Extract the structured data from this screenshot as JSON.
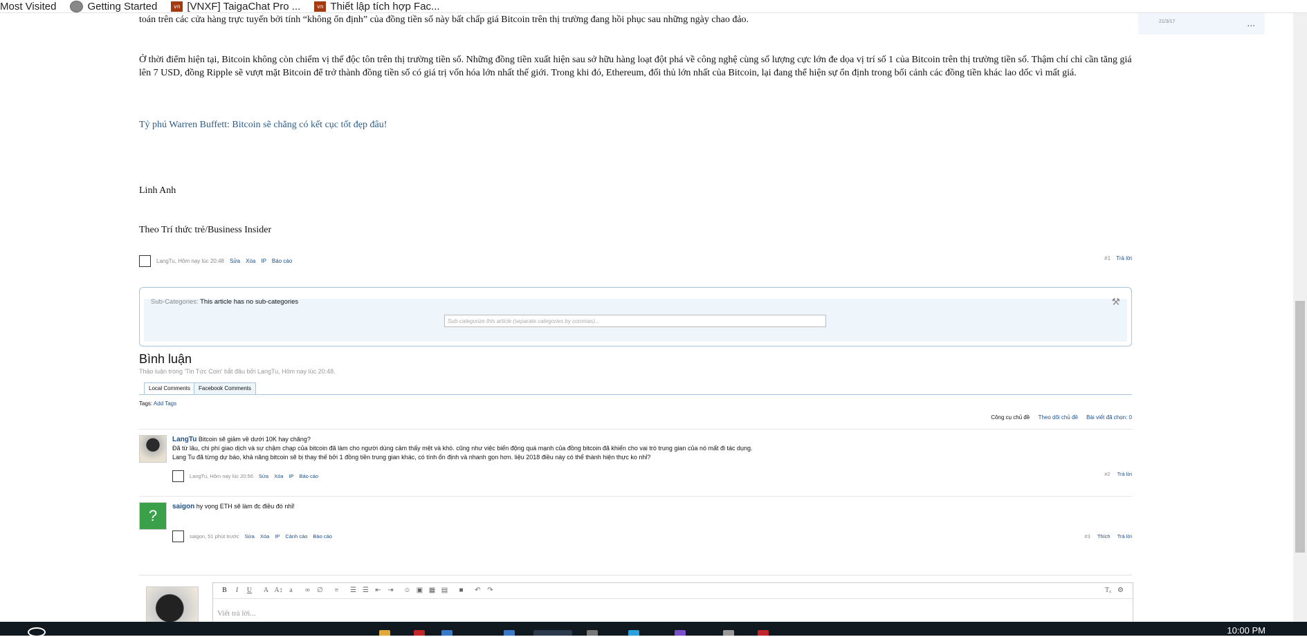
{
  "bookmarks": [
    {
      "label": "Most Visited",
      "icon": "folder-icon"
    },
    {
      "label": "Getting Started",
      "icon": "globe-icon"
    },
    {
      "label": "[VNXF] TaigaChat Pro ...",
      "icon": "vnxf-icon"
    },
    {
      "label": "Thiết lập tích hợp Fac...",
      "icon": "vnxf-icon"
    }
  ],
  "article": {
    "p1": "toán trên các cửa hàng trực tuyến bởi tính “không ổn định” của đồng tiền số này bất chấp giá Bitcoin trên thị trường đang hồi phục sau những ngày chao đảo.",
    "p2": "Ở thời điểm hiện tại, Bitcoin không còn chiếm vị thế độc tôn trên thị trường tiền số. Những đồng tiền xuất hiện sau sở hữu hàng loạt đột phá về công nghệ cùng số lượng cực lớn đe dọa vị trí số 1 của Bitcoin trên thị trường tiền số. Thậm chí chỉ cần tăng giá lên 7 USD, đồng Ripple sẽ vượt mặt Bitcoin để trở thành đồng tiền số có giá trị vốn hóa lớn nhất thế giới. Trong khi đó, Ethereum, đối thủ lớn nhất của Bitcoin, lại đang thể hiện sự ổn định trong bối cảnh các đồng tiền khác lao dốc vì mất giá.",
    "link": "Tỷ phú Warren Buffett: Bitcoin sẽ chẳng có kết cục tốt đẹp đâu!",
    "author": "Linh Anh",
    "source": "Theo Trí thức trẻ/Business Insider",
    "byline": {
      "meta": "LangTu, Hôm nay lúc 20:48",
      "edit": "Sửa",
      "delete": "Xóa",
      "ip": "IP",
      "report": "Báo cáo",
      "num": "#1",
      "reply": "Trả lời"
    }
  },
  "sidebar": {
    "date": "21/3/17",
    "more": "..."
  },
  "subcat": {
    "label": "Sub-Categories:",
    "value": "This article has no sub-categories",
    "placeholder": "Sub-categorize this article (separate categories by commas)..."
  },
  "comments_section": {
    "title": "Bình luận",
    "subtitle": "Thảo luận trong 'Tin Tức Coin' bắt đầu bởi LangTu, Hôm nay lúc 20:48.",
    "tabs": [
      "Local Comments",
      "Facebook Comments"
    ],
    "tags_label": "Tags:",
    "add_tags": "Add Tags",
    "tools": {
      "thread_tools": "Công cụ chủ đề",
      "watch": "Theo dõi chủ đề",
      "selected": "Bài viết đã chọn: 0"
    }
  },
  "posts": [
    {
      "user": "LangTu",
      "lines": [
        "Bitcoin sẽ giảm về dưới 10K hay chăng?",
        "Đã từ lâu, chi phí giao dịch và sự chậm chạp của bitcoin đã làm cho người dùng cảm thấy mệt và khó. cũng như việc biến động quá mạnh của đồng bitcoin đã khiến cho vai trò trung gian của nó mất đi tác dụng.",
        "Lang Tu đã từng dự báo, khả năng bitcoin sẽ bị thay thế bởi 1 đồng tiền trung gian khác, có tính ổn định và nhanh gọn hơn. liệu 2018 điều này có thể thành hiện thực ko nhỉ?"
      ],
      "meta": "LangTu, Hôm nay lúc 20:56",
      "actions": [
        "Sửa",
        "Xóa",
        "IP",
        "Báo cáo"
      ],
      "num": "#2",
      "right_actions": [
        "Trả lời"
      ]
    },
    {
      "user": "saigon",
      "lines": [
        "hy vọng ETH sẽ làm đc điều đó nhỉ!"
      ],
      "meta": "saigon, 51 phút trước",
      "actions": [
        "Sửa",
        "Xóa",
        "IP",
        "Cảnh cáo",
        "Báo cáo"
      ],
      "num": "#3",
      "right_actions": [
        "Thích",
        "Trả lời"
      ]
    }
  ],
  "editor": {
    "placeholder": "Viết trả lời..."
  },
  "taskbar": {
    "clock": "10:00 PM"
  }
}
